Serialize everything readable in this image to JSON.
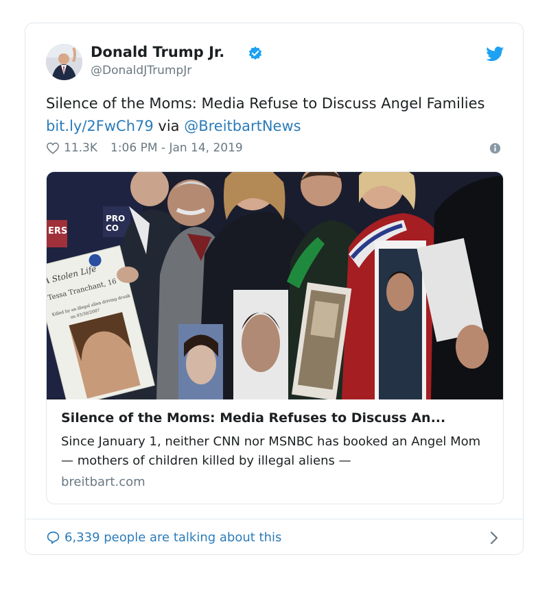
{
  "tweet": {
    "author_name": "Donald Trump Jr.",
    "author_handle": "@DonaldJTrumpJr",
    "text_before_link": "Silence of the Moms: Media Refuse to Discuss Angel Families ",
    "link_text": "bit.ly/2FwCh79",
    "text_via": " via ",
    "mention_text": "@BreitbartNews",
    "likes": "11.3K",
    "timestamp": "1:06 PM - Jan 14, 2019"
  },
  "link_card": {
    "title": "Silence of the Moms: Media Refuses to Discuss An...",
    "description": "Since January 1, neither CNN nor MSNBC has booked an Angel Mom — mothers of children killed by illegal aliens —",
    "domain": "breitbart.com",
    "photo_sign_text": "A Stolen Life Tessa Tranchant, 16 Killed by an illegal alien driving drunk on 03/30/2007",
    "photo_backdrop_text": "PRO CO ERS"
  },
  "footer": {
    "talking_text": "6,339 people are talking about this"
  },
  "colors": {
    "link_blue": "#2b7bb9",
    "verified_blue": "#1da1f2",
    "meta_gray": "#697882",
    "border": "#e1e8ed"
  },
  "icons": [
    "verified-badge-icon",
    "twitter-bird-icon",
    "heart-icon",
    "info-icon",
    "speech-bubble-icon",
    "chevron-right-icon"
  ]
}
